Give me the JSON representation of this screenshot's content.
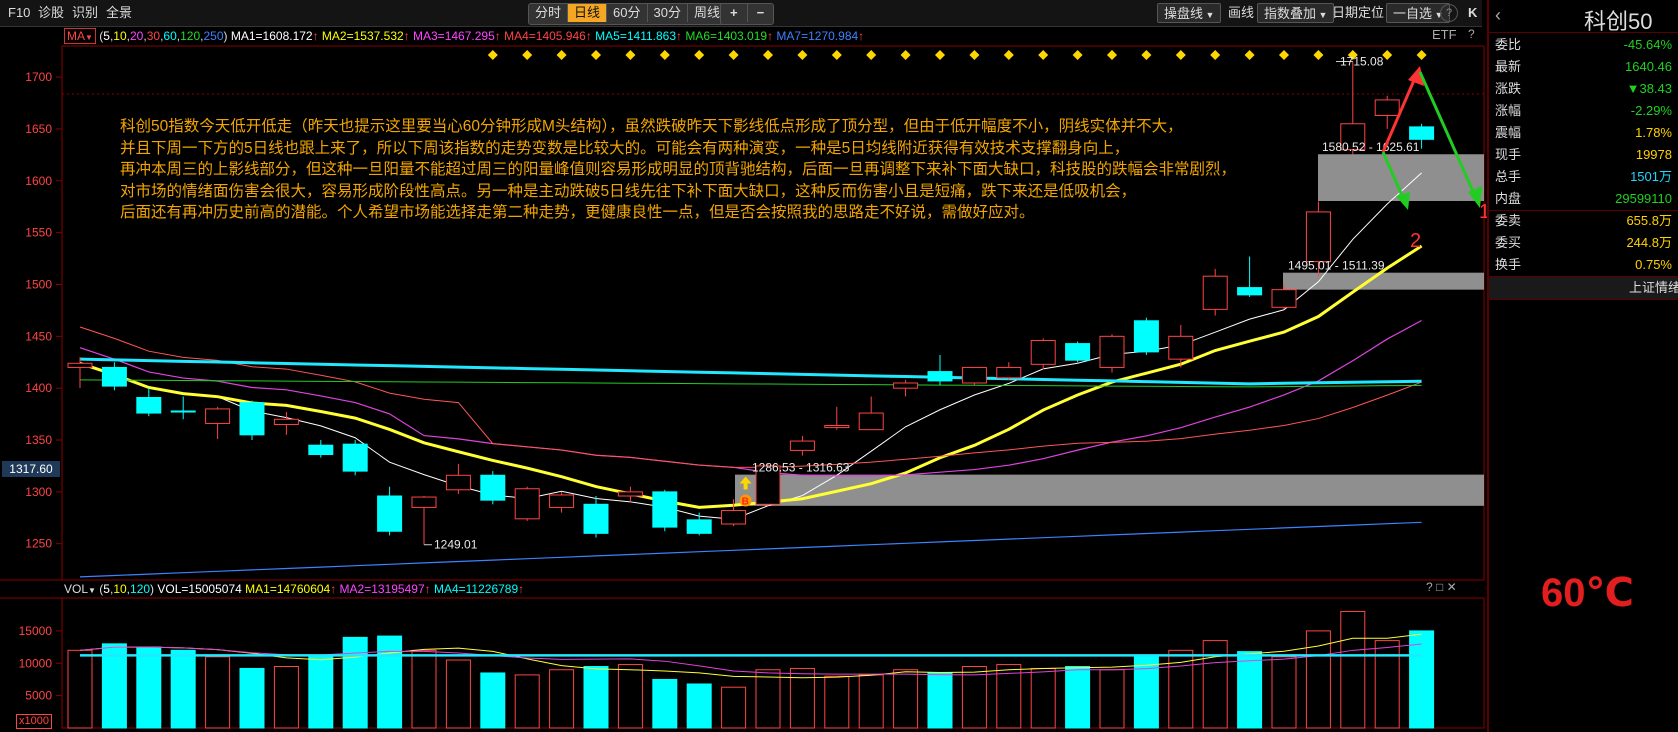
{
  "toolbar": {
    "f10": "F10",
    "diagnose": "诊股",
    "identify": "识别",
    "fullscreen": "全景",
    "periods": [
      "分时",
      "日线",
      "60分",
      "30分",
      "周线"
    ],
    "active_period": "日线",
    "zoom_in": "+",
    "zoom_out": "−",
    "pan_line": "操盘线",
    "draw": "画线",
    "index_overlay": "指数叠加",
    "date_locate": "日期定位",
    "watchlist": "一自选",
    "help": "?",
    "collapse": "K"
  },
  "ma_legend": {
    "indicator": "MA",
    "params": "(5,10,20,30,60,120,250)",
    "items": [
      {
        "label": "MA1=1608.172",
        "color": "#ffffff"
      },
      {
        "label": "MA2=1537.532",
        "color": "#ffff00"
      },
      {
        "label": "MA3=1467.295",
        "color": "#ff44ff"
      },
      {
        "label": "MA4=1405.946",
        "color": "#ff4444"
      },
      {
        "label": "MA5=1411.863",
        "color": "#00ffff"
      },
      {
        "label": "MA6=1403.019",
        "color": "#22dd22"
      },
      {
        "label": "MA7=1270.984",
        "color": "#3b82ff"
      }
    ],
    "etf": "ETF",
    "q": "?"
  },
  "price_axis": {
    "ticks": [
      "1700",
      "1650",
      "1600",
      "1550",
      "1500",
      "1450",
      "1400",
      "1350",
      "1300",
      "1250"
    ],
    "current_tag": "1317.60"
  },
  "annotation_text": [
    "科创50指数今天低开低走（昨天也提示这里要当心60分钟形成M头结构），虽然跌破昨天下影线低点形成了顶分型，但由于低开幅度不小，阴线实体并不大，",
    "并且下周一下方的5日线也跟上来了，所以下周该指数的走势变数是比较大的。可能会有两种演变，一种是5日均线附近获得有效技术支撑翻身向上，",
    "再冲本周三的上影线部分，但这种一旦阳量不能超过周三的阳量峰值则容易形成明显的顶背驰结构，后面一旦再调整下来补下面大缺口，科技股的跌幅会非常剧烈，",
    "对市场的情绪面伤害会很大，容易形成阶段性高点。另一种是主动跌破5日线先往下补下面大缺口，这种反而伤害小且是短痛，跌下来还是低吸机会，",
    "后面还有再冲历史前高的潜能。个人希望市场能选择走第二种走势，更健康良性一点，但是否会按照我的思路走不好说，需做好应对。"
  ],
  "chart_labels": {
    "high": "1715.08",
    "gap_top": "1580.52 - 1625.61",
    "gap_mid": "1495.01 - 1511.39",
    "gap_low": "1286.53 - 1316.63",
    "low": "1249.01",
    "b_marker": "B",
    "arrow1": "1",
    "arrow2": "2"
  },
  "vol_legend": {
    "indicator": "VOL",
    "params": "(5,10,120)",
    "items": [
      {
        "label": "VOL=15005074",
        "color": "#ffffff"
      },
      {
        "label": "MA1=14760604",
        "color": "#ffff00"
      },
      {
        "label": "MA2=13195497",
        "color": "#ff44ff"
      },
      {
        "label": "MA4=11226789",
        "color": "#00ffff"
      }
    ],
    "ticks": [
      "15000",
      "10000",
      "5000"
    ],
    "unit": "x1000",
    "q": "?"
  },
  "right_panel": {
    "title": "科创50",
    "rows": [
      {
        "k": "委比",
        "v": "-45.64%",
        "color": "green"
      },
      {
        "k": "最新",
        "v": "1640.46",
        "color": "green"
      },
      {
        "k": "涨跌",
        "v": "▼38.43",
        "color": "green"
      },
      {
        "k": "涨幅",
        "v": "-2.29%",
        "color": "green"
      },
      {
        "k": "震幅",
        "v": "1.78%",
        "color": "yellow"
      },
      {
        "k": "现手",
        "v": "19978",
        "color": "yellow"
      },
      {
        "k": "总手",
        "v": "1501万",
        "color": "cyan"
      },
      {
        "k": "内盘",
        "v": "29599110",
        "color": "green"
      },
      {
        "k": "委卖",
        "v": "655.8万",
        "color": "yellow"
      },
      {
        "k": "委买",
        "v": "244.8万",
        "color": "yellow"
      },
      {
        "k": "换手",
        "v": "0.75%",
        "color": "yellow"
      }
    ],
    "footer": "上证情绪",
    "temperature": "60℃"
  },
  "chart_data": {
    "type": "candlestick",
    "ylim": [
      1215,
      1730
    ],
    "candles": [
      {
        "o": 1420,
        "h": 1430,
        "l": 1400,
        "c": 1424,
        "up": true
      },
      {
        "o": 1420,
        "h": 1425,
        "l": 1398,
        "c": 1402,
        "up": false
      },
      {
        "o": 1391,
        "h": 1400,
        "l": 1373,
        "c": 1376,
        "up": false
      },
      {
        "o": 1378,
        "h": 1392,
        "l": 1370,
        "c": 1377,
        "up": false
      },
      {
        "o": 1366,
        "h": 1382,
        "l": 1351,
        "c": 1380,
        "up": true
      },
      {
        "o": 1386,
        "h": 1388,
        "l": 1350,
        "c": 1355,
        "up": false
      },
      {
        "o": 1365,
        "h": 1377,
        "l": 1355,
        "c": 1370,
        "up": true
      },
      {
        "o": 1345,
        "h": 1350,
        "l": 1333,
        "c": 1336,
        "up": false
      },
      {
        "o": 1346,
        "h": 1350,
        "l": 1316,
        "c": 1320,
        "up": false
      },
      {
        "o": 1296,
        "h": 1305,
        "l": 1258,
        "c": 1262,
        "up": false
      },
      {
        "o": 1285,
        "h": 1296,
        "l": 1249,
        "c": 1295,
        "up": true
      },
      {
        "o": 1302,
        "h": 1327,
        "l": 1298,
        "c": 1316,
        "up": true
      },
      {
        "o": 1316,
        "h": 1320,
        "l": 1288,
        "c": 1292,
        "up": false
      },
      {
        "o": 1274,
        "h": 1305,
        "l": 1272,
        "c": 1303,
        "up": true
      },
      {
        "o": 1285,
        "h": 1300,
        "l": 1280,
        "c": 1297,
        "up": true
      },
      {
        "o": 1288,
        "h": 1296,
        "l": 1256,
        "c": 1260,
        "up": false
      },
      {
        "o": 1296,
        "h": 1305,
        "l": 1290,
        "c": 1300,
        "up": true
      },
      {
        "o": 1300,
        "h": 1302,
        "l": 1262,
        "c": 1266,
        "up": false
      },
      {
        "o": 1273,
        "h": 1280,
        "l": 1258,
        "c": 1260,
        "up": false
      },
      {
        "o": 1269,
        "h": 1293,
        "l": 1267,
        "c": 1282,
        "up": true
      },
      {
        "o": 1288,
        "h": 1327,
        "l": 1286,
        "c": 1325,
        "up": true
      },
      {
        "o": 1340,
        "h": 1354,
        "l": 1335,
        "c": 1349,
        "up": true
      },
      {
        "o": 1362,
        "h": 1382,
        "l": 1360,
        "c": 1364,
        "up": true
      },
      {
        "o": 1360,
        "h": 1392,
        "l": 1360,
        "c": 1376,
        "up": true
      },
      {
        "o": 1405,
        "h": 1408,
        "l": 1392,
        "c": 1400,
        "up": true
      },
      {
        "o": 1416,
        "h": 1432,
        "l": 1403,
        "c": 1407,
        "up": false
      },
      {
        "o": 1405,
        "h": 1420,
        "l": 1403,
        "c": 1420,
        "up": true
      },
      {
        "o": 1410,
        "h": 1425,
        "l": 1408,
        "c": 1420,
        "up": true
      },
      {
        "o": 1423,
        "h": 1448,
        "l": 1418,
        "c": 1446,
        "up": true
      },
      {
        "o": 1443,
        "h": 1445,
        "l": 1425,
        "c": 1427,
        "up": false
      },
      {
        "o": 1420,
        "h": 1452,
        "l": 1415,
        "c": 1450,
        "up": true
      },
      {
        "o": 1465,
        "h": 1468,
        "l": 1432,
        "c": 1435,
        "up": false
      },
      {
        "o": 1428,
        "h": 1461,
        "l": 1420,
        "c": 1450,
        "up": true
      },
      {
        "o": 1476,
        "h": 1515,
        "l": 1470,
        "c": 1508,
        "up": true
      },
      {
        "o": 1497,
        "h": 1527,
        "l": 1488,
        "c": 1490,
        "up": false
      },
      {
        "o": 1478,
        "h": 1500,
        "l": 1476,
        "c": 1495,
        "up": true
      },
      {
        "o": 1522,
        "h": 1580,
        "l": 1508,
        "c": 1570,
        "up": true
      },
      {
        "o": 1630,
        "h": 1715,
        "l": 1625,
        "c": 1655,
        "up": true
      },
      {
        "o": 1663,
        "h": 1682,
        "l": 1650,
        "c": 1678,
        "up": true
      },
      {
        "o": 1652,
        "h": 1655,
        "l": 1631,
        "c": 1640,
        "up": false
      }
    ],
    "volume": [
      {
        "v": 12000,
        "up": true
      },
      {
        "v": 13000,
        "up": false
      },
      {
        "v": 12500,
        "up": false
      },
      {
        "v": 12000,
        "up": false
      },
      {
        "v": 11000,
        "up": true
      },
      {
        "v": 9200,
        "up": false
      },
      {
        "v": 9500,
        "up": true
      },
      {
        "v": 11000,
        "up": false
      },
      {
        "v": 14000,
        "up": false
      },
      {
        "v": 14200,
        "up": false
      },
      {
        "v": 12000,
        "up": true
      },
      {
        "v": 10500,
        "up": true
      },
      {
        "v": 8500,
        "up": false
      },
      {
        "v": 8200,
        "up": true
      },
      {
        "v": 9000,
        "up": true
      },
      {
        "v": 9500,
        "up": false
      },
      {
        "v": 9800,
        "up": true
      },
      {
        "v": 7500,
        "up": false
      },
      {
        "v": 6800,
        "up": false
      },
      {
        "v": 6300,
        "up": true
      },
      {
        "v": 9000,
        "up": true
      },
      {
        "v": 9200,
        "up": true
      },
      {
        "v": 8000,
        "up": true
      },
      {
        "v": 8200,
        "up": true
      },
      {
        "v": 9000,
        "up": true
      },
      {
        "v": 8500,
        "up": false
      },
      {
        "v": 9500,
        "up": true
      },
      {
        "v": 9800,
        "up": true
      },
      {
        "v": 9200,
        "up": true
      },
      {
        "v": 9500,
        "up": false
      },
      {
        "v": 9000,
        "up": true
      },
      {
        "v": 11000,
        "up": false
      },
      {
        "v": 12000,
        "up": true
      },
      {
        "v": 13500,
        "up": true
      },
      {
        "v": 11800,
        "up": false
      },
      {
        "v": 11000,
        "up": true
      },
      {
        "v": 15000,
        "up": true
      },
      {
        "v": 18000,
        "up": true
      },
      {
        "v": 13500,
        "up": true
      },
      {
        "v": 15000,
        "up": false
      }
    ],
    "vol_ylim": [
      0,
      19000
    ],
    "gaps": [
      {
        "low": 1580.52,
        "high": 1625.61
      },
      {
        "low": 1495.01,
        "high": 1511.39
      },
      {
        "low": 1286.53,
        "high": 1316.63
      }
    ]
  }
}
